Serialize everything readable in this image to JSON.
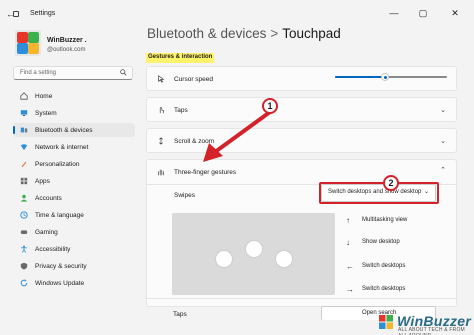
{
  "window": {
    "title": "Settings",
    "minimize": "—",
    "maximize": "▢",
    "close": "✕",
    "back": "←"
  },
  "user": {
    "name": "WinBuzzer .",
    "email": "@outlook.com"
  },
  "search": {
    "placeholder": "Find a setting"
  },
  "nav": [
    {
      "label": "Home",
      "icon": "home-icon"
    },
    {
      "label": "System",
      "icon": "monitor-icon"
    },
    {
      "label": "Bluetooth & devices",
      "icon": "bluetooth-icon",
      "active": true
    },
    {
      "label": "Network & internet",
      "icon": "network-icon"
    },
    {
      "label": "Personalization",
      "icon": "brush-icon"
    },
    {
      "label": "Apps",
      "icon": "apps-icon"
    },
    {
      "label": "Accounts",
      "icon": "account-icon"
    },
    {
      "label": "Time & language",
      "icon": "clock-globe-icon"
    },
    {
      "label": "Gaming",
      "icon": "gamepad-icon"
    },
    {
      "label": "Accessibility",
      "icon": "accessibility-icon"
    },
    {
      "label": "Privacy & security",
      "icon": "shield-icon"
    },
    {
      "label": "Windows Update",
      "icon": "update-icon"
    }
  ],
  "breadcrumb": {
    "parent": "Bluetooth & devices",
    "separator": ">",
    "current": "Touchpad"
  },
  "section": "Gestures & interaction",
  "cursor_speed": {
    "label": "Cursor speed",
    "value_fraction": 0.45
  },
  "cards": {
    "taps": "Taps",
    "scroll": "Scroll & zoom",
    "three_finger": "Three-finger gestures",
    "swipes": "Swipes",
    "taps2": "Taps"
  },
  "swipes_dropdown": {
    "value": "Switch desktops and show desktop"
  },
  "swipe_options": [
    {
      "arrow": "↑",
      "label": "Multitasking view"
    },
    {
      "arrow": "↓",
      "label": "Show desktop"
    },
    {
      "arrow": "←",
      "label": "Switch desktops"
    },
    {
      "arrow": "→",
      "label": "Switch desktops"
    }
  ],
  "taps_dropdown": {
    "value": "Open search"
  },
  "annotations": {
    "one": "1",
    "two": "2",
    "color": "#d4222a"
  },
  "watermark": {
    "brand": "WinBuzzer",
    "tagline": "ALL ABOUT TECH & FROM ALL AROUND"
  },
  "colors": {
    "accent": "#0067c0",
    "highlight": "#fff36b"
  }
}
